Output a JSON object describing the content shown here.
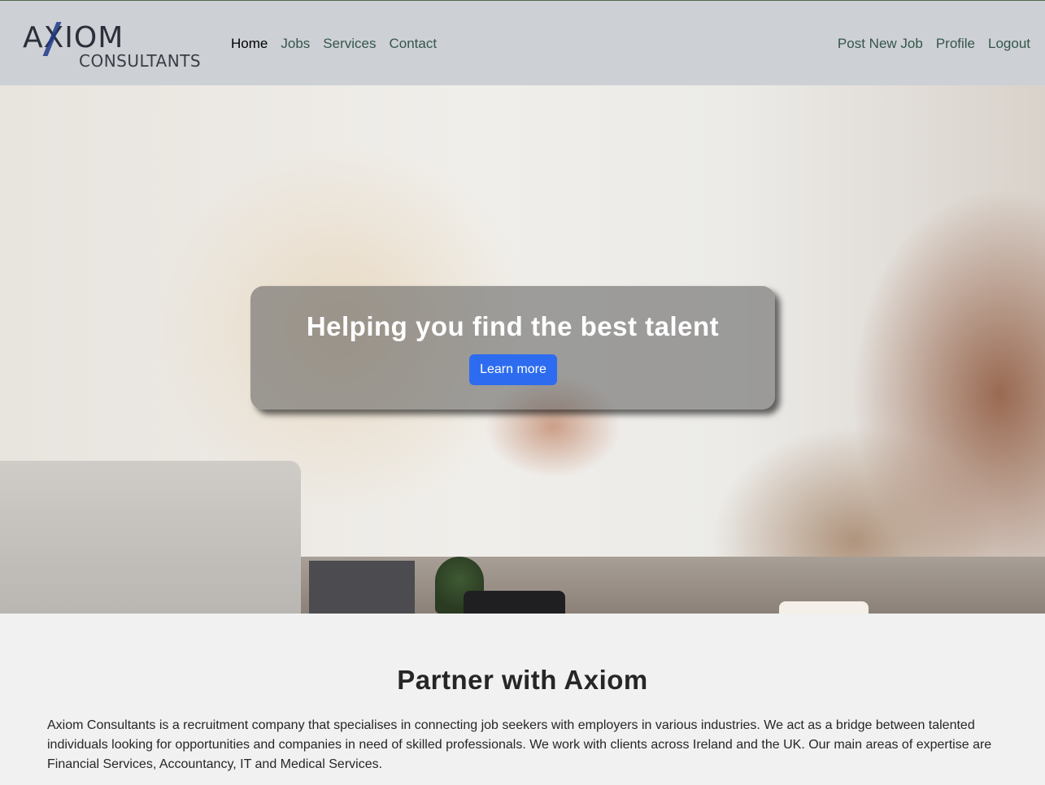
{
  "brand": {
    "logo_top": "AXIOM",
    "logo_bottom": "CONSULTANTS"
  },
  "nav": {
    "left": [
      {
        "label": "Home",
        "active": true
      },
      {
        "label": "Jobs",
        "active": false
      },
      {
        "label": "Services",
        "active": false
      },
      {
        "label": "Contact",
        "active": false
      }
    ],
    "right": [
      {
        "label": "Post New Job"
      },
      {
        "label": "Profile"
      },
      {
        "label": "Logout"
      }
    ]
  },
  "hero": {
    "title": "Helping you find the best talent",
    "button_label": "Learn more"
  },
  "about": {
    "title": "Partner with Axiom",
    "text": "Axiom Consultants is a recruitment company that specialises in connecting job seekers with employers in various industries. We act as a bridge between talented individuals looking for opportunities and companies in need of skilled professionals. We work with clients across Ireland and the UK. Our main areas of expertise are Financial Services, Accountancy, IT and Medical Services."
  },
  "colors": {
    "navbar_bg": "#cdd0d5",
    "nav_link": "#35564a",
    "primary_button": "#2d6cf0",
    "section_bg": "#f1f1f1"
  }
}
